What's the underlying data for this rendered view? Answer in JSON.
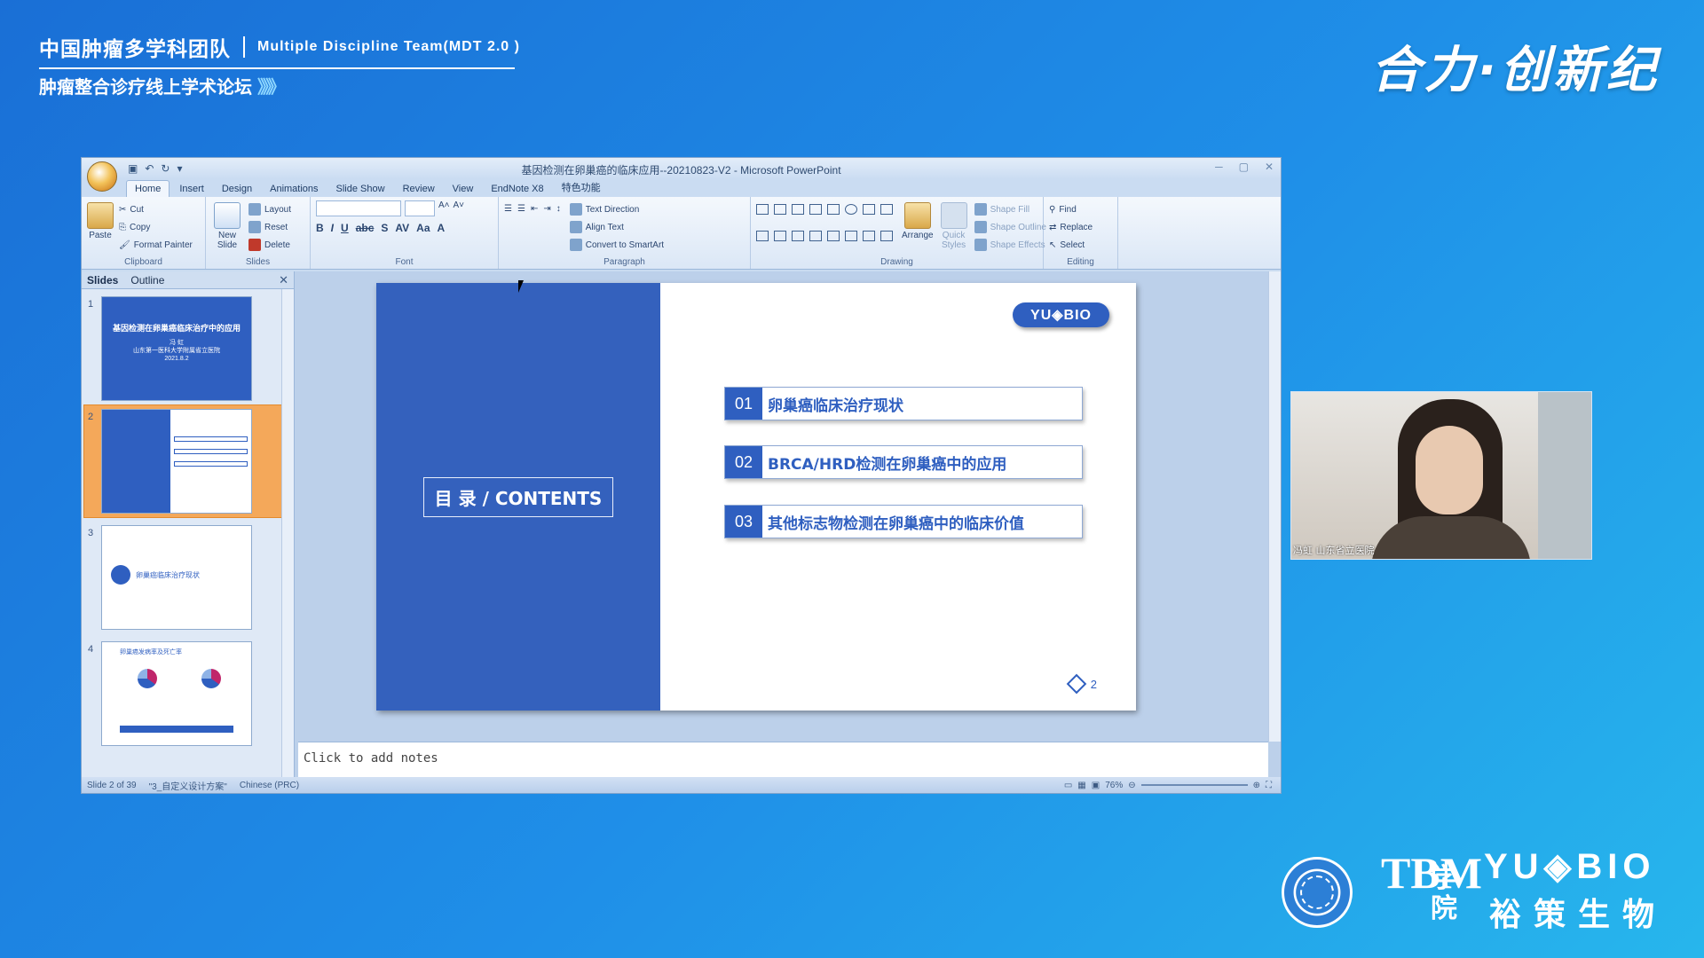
{
  "banner": {
    "title_cn": "中国肿瘤多学科团队",
    "title_en": "Multiple Discipline Team(MDT 2.0 )",
    "subtitle": "肿瘤整合诊疗线上学术论坛",
    "chevrons": "》》》"
  },
  "slogan": "合力·创新纪",
  "ppt": {
    "window_title": "基因检测在卵巢癌的临床应用--20210823-V2 - Microsoft PowerPoint",
    "tabs": [
      "Home",
      "Insert",
      "Design",
      "Animations",
      "Slide Show",
      "Review",
      "View",
      "EndNote X8",
      "特色功能"
    ],
    "active_tab": "Home",
    "ribbon": {
      "clipboard": {
        "paste": "Paste",
        "cut": "Cut",
        "copy": "Copy",
        "format_painter": "Format Painter",
        "label": "Clipboard"
      },
      "slides": {
        "new_slide": "New Slide",
        "layout": "Layout",
        "reset": "Reset",
        "delete": "Delete",
        "label": "Slides"
      },
      "font": {
        "label": "Font"
      },
      "paragraph": {
        "text_direction": "Text Direction",
        "align_text": "Align Text",
        "convert_smartart": "Convert to SmartArt",
        "label": "Paragraph"
      },
      "drawing": {
        "arrange": "Arrange",
        "quick_styles": "Quick Styles",
        "shape_fill": "Shape Fill",
        "shape_outline": "Shape Outline",
        "shape_effects": "Shape Effects",
        "label": "Drawing"
      },
      "editing": {
        "find": "Find",
        "replace": "Replace",
        "select": "Select",
        "label": "Editing"
      }
    },
    "pane_tabs": {
      "slides": "Slides",
      "outline": "Outline"
    },
    "thumbnails": [
      {
        "num": "1",
        "title": "基因检测在卵巢癌临床治疗中的应用",
        "sub": "冯 虹\n山东第一医科大学附属省立医院\n2021.8.2"
      },
      {
        "num": "2"
      },
      {
        "num": "3",
        "title": "卵巢癌临床治疗现状"
      },
      {
        "num": "4",
        "title": "卵巢癌发病率及死亡率"
      }
    ],
    "slide": {
      "contents_label": "目 录 / CONTENTS",
      "logo": "YU◈BIO",
      "items": [
        {
          "num": "01",
          "text": "卵巢癌临床治疗现状"
        },
        {
          "num": "02",
          "text": "BRCA/HRD检测在卵巢癌中的应用"
        },
        {
          "num": "03",
          "text": "其他标志物检测在卵巢癌中的临床价值"
        }
      ],
      "page_number": "2"
    },
    "notes_placeholder": "Click to add notes",
    "status": {
      "slide_info": "Slide 2 of 39",
      "theme": "\"3_自定义设计方案\"",
      "language": "Chinese (PRC)",
      "zoom": "76%"
    }
  },
  "webcam": {
    "label": "冯虹 山东省立医院"
  },
  "footer": {
    "tbm": "TBM",
    "tbm_cn": "学院",
    "brand_en": "YU◈BIO",
    "brand_cn": "裕策生物"
  }
}
